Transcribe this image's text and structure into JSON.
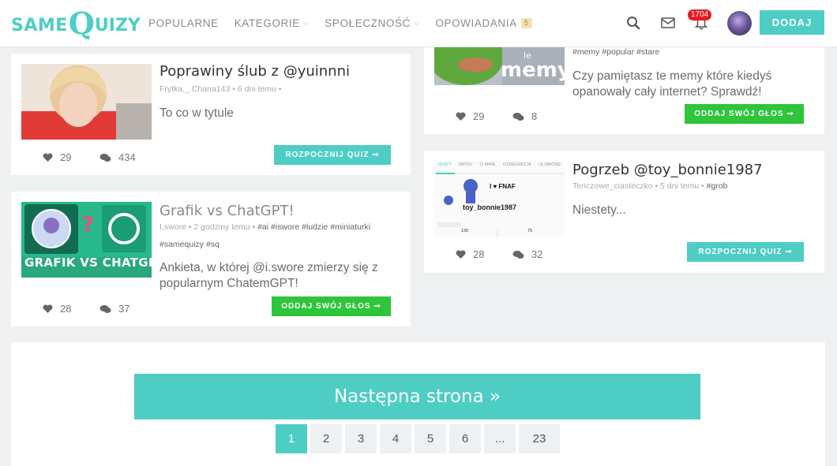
{
  "header": {
    "logo": {
      "same": "SAME",
      "q": "Q",
      "uizy": "UIZY"
    },
    "nav": [
      {
        "label": "POPULARNE",
        "has_chevron": false
      },
      {
        "label": "KATEGORIE",
        "has_chevron": true
      },
      {
        "label": "SPOŁECZNOŚĆ",
        "has_chevron": true
      },
      {
        "label": "OPOWIADANIA",
        "badge": "5"
      }
    ],
    "chevron": "⌵",
    "icons": [
      "search-icon",
      "mail-icon",
      "bell-icon"
    ],
    "notification_count": "1704",
    "add_button": "DODAJ"
  },
  "cards": [
    {
      "title": "Poprawiny ślub z @yuinnni",
      "meta": "Frytka._.Chana143 • 6 dni temu •",
      "tags": "",
      "description": "To co w tytule",
      "likes": "29",
      "comments": "434",
      "button": "ROZPOCZNIJ QUIZ ➞"
    },
    {
      "title": "Grafik vs ChatGPT!",
      "meta": "I.swore • 2 godziny temu •",
      "tags": "#ai #iswore #ludzie #miniaturki",
      "tags2": "#samequizy #sq",
      "description": "Ankieta, w której @i.swore zmierzy się z popularnym ChatemGPT!",
      "likes": "28",
      "comments": "37",
      "button": "ODDAJ SWÓJ GŁOS ➞",
      "thumb_text": "GRAFIK VS CHATGPT"
    },
    {
      "title": "",
      "meta": "",
      "tags": "#memy #popular #stare",
      "description": "Czy pamiętasz te memy które kiedyś opanowały cały internet? Sprawdź!",
      "likes": "29",
      "comments": "8",
      "button": "ODDAJ SWÓJ GŁOS ➞",
      "thumb_text": "memy"
    },
    {
      "title": "Pogrzeb @toy_bonnie1987",
      "meta": "Tenczowe_ciasteczko • 5 dni temu •",
      "tags": "#grob",
      "description": "Niestety...",
      "likes": "28",
      "comments": "32",
      "button": "ROZPOCZNIJ QUIZ ➞",
      "thumb_username": "toy_bonnie1987",
      "thumb_tabs": [
        "QUIZY",
        "WPISY",
        "O MNIE",
        "OSIĄGNIĘCIA",
        "ULUBIONE"
      ],
      "thumb_stats": [
        "130",
        "75"
      ],
      "thumb_sign": "I ♥ FNAF"
    }
  ],
  "pagination": {
    "next": "Następna strona »",
    "pages": [
      "1",
      "2",
      "3",
      "4",
      "5",
      "6",
      "...",
      "23"
    ],
    "active": "1"
  },
  "colors": {
    "accent": "#4ecdc4",
    "green": "#2fc53a",
    "badge": "#e51c23"
  }
}
